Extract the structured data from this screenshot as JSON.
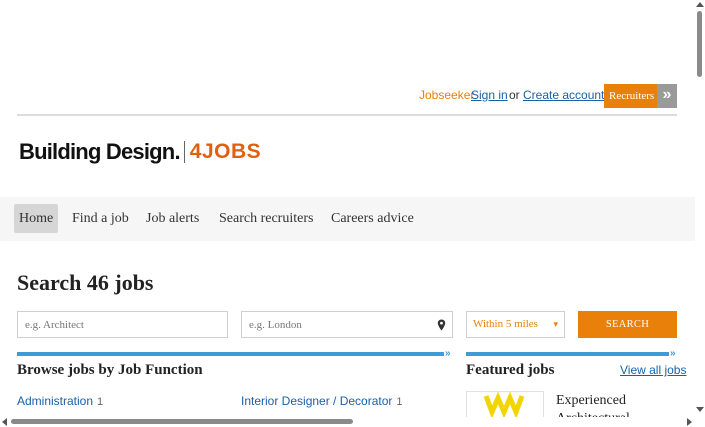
{
  "account": {
    "jobseeker_label": "Jobseeker",
    "sign_in": "Sign in",
    "or": "or",
    "create_account": "Create account",
    "recruiters": "Recruiters",
    "recruiters_arrow": "»"
  },
  "brand": {
    "main": "Building Design.",
    "jobs": "4JOBS",
    "accent_color": "#e8800a"
  },
  "nav": {
    "items": [
      {
        "label": "Home",
        "active": true
      },
      {
        "label": "Find a job"
      },
      {
        "label": "Job alerts"
      },
      {
        "label": "Search recruiters"
      },
      {
        "label": "Careers advice"
      }
    ]
  },
  "search": {
    "title": "Search 46 jobs",
    "keywords_placeholder": "e.g. Architect",
    "location_placeholder": "e.g. London",
    "radius_value": "Within 5 miles",
    "button_label": "SEARCH"
  },
  "browse": {
    "title": "Browse jobs by Job Function",
    "functions": [
      {
        "label": "Administration",
        "count": "1"
      },
      {
        "label": "Interior Designer / Decorator",
        "count": "1"
      }
    ]
  },
  "featured": {
    "title": "Featured jobs",
    "view_all": "View all jobs",
    "job_title": "Experienced Architectural"
  },
  "icons": {
    "location": "map-pin-icon",
    "section_chevron": "»",
    "select_chevron": "▾"
  }
}
